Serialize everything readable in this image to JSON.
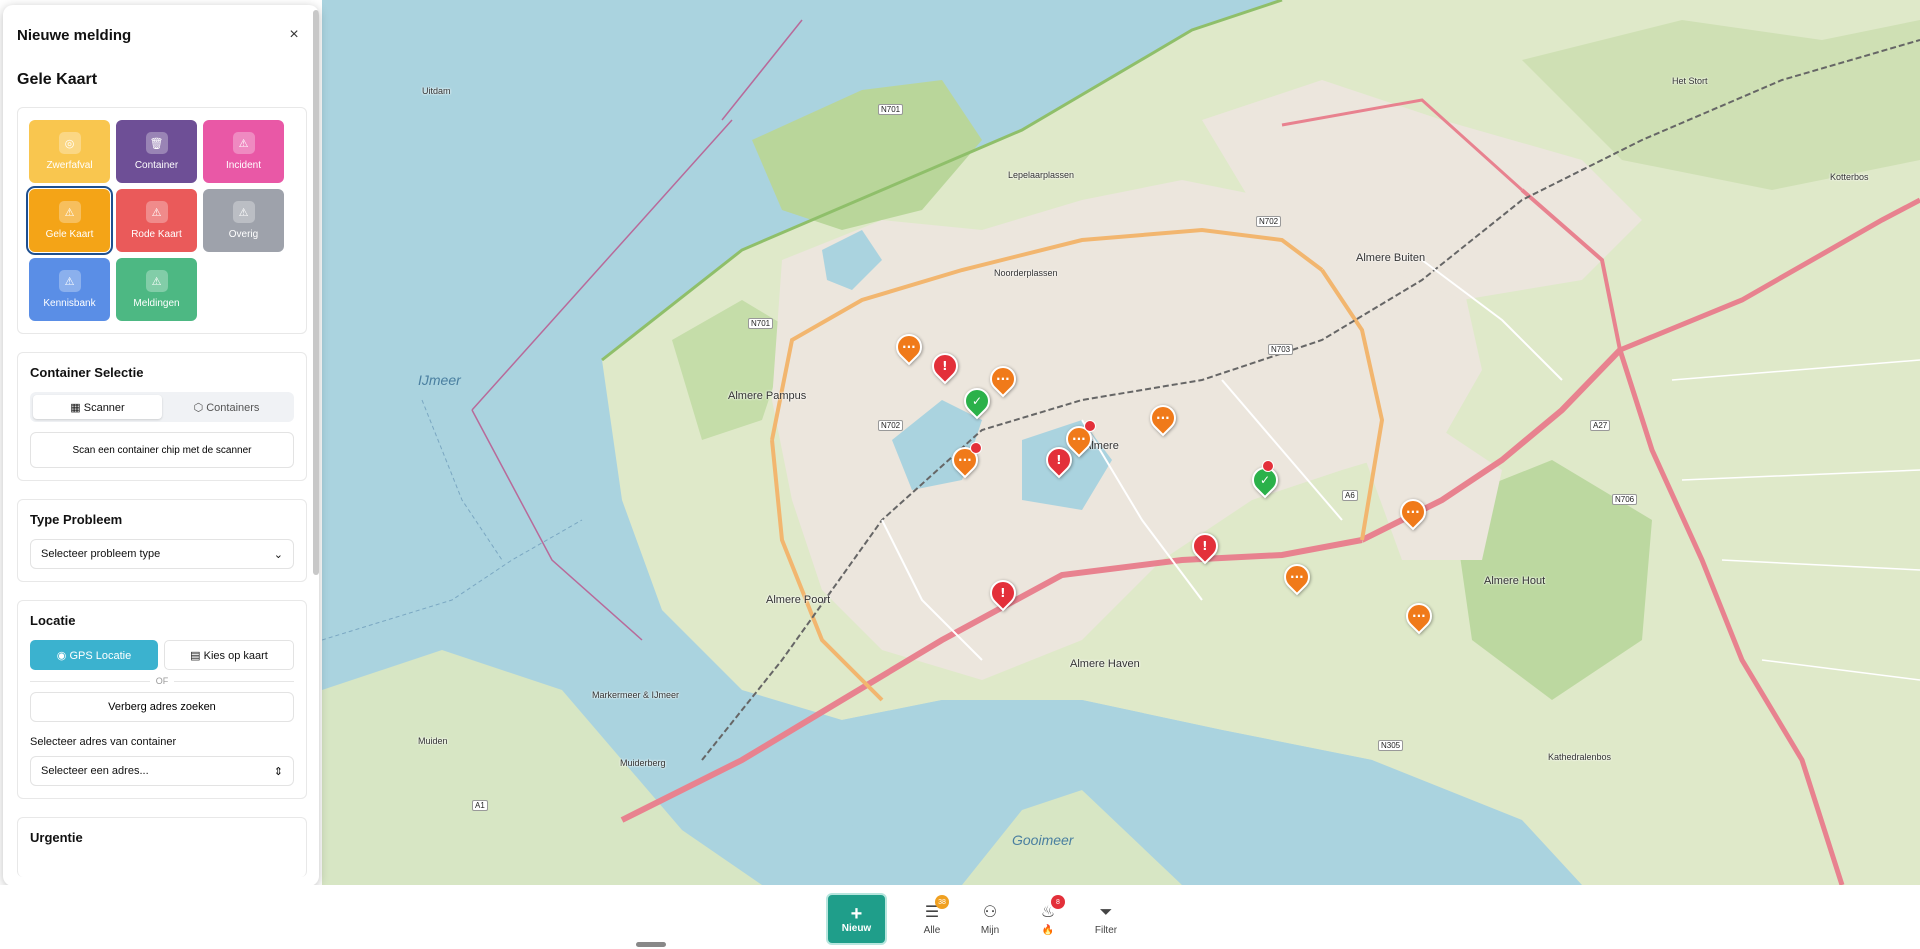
{
  "panel": {
    "title": "Nieuwe melding",
    "subtitle": "Gele Kaart",
    "close_label": "×"
  },
  "categories": [
    {
      "label": "Zwerfafval",
      "icon": "map-pin-icon",
      "color": "#f9c64f",
      "selected": false
    },
    {
      "label": "Container",
      "icon": "trash-icon",
      "color": "#6e4f96",
      "selected": false
    },
    {
      "label": "Incident",
      "icon": "warning-icon",
      "color": "#e958a6",
      "selected": false
    },
    {
      "label": "Gele Kaart",
      "icon": "warning-icon",
      "color": "#f4a417",
      "selected": true
    },
    {
      "label": "Rode Kaart",
      "icon": "warning-icon",
      "color": "#ea5a5a",
      "selected": false
    },
    {
      "label": "Overig",
      "icon": "warning-icon",
      "color": "#9ea2ab",
      "selected": false
    },
    {
      "label": "Kennisbank",
      "icon": "warning-icon",
      "color": "#5a8ee6",
      "selected": false
    },
    {
      "label": "Meldingen",
      "icon": "warning-icon",
      "color": "#4db883",
      "selected": false
    }
  ],
  "container": {
    "title": "Container Selectie",
    "tab_scanner": "Scanner",
    "tab_containers": "Containers",
    "scan_button": "Scan een container chip met de scanner"
  },
  "problem": {
    "title": "Type Probleem",
    "select_placeholder": "Selecteer probleem type"
  },
  "location": {
    "title": "Locatie",
    "gps_button": "GPS Locatie",
    "map_button": "Kies op kaart",
    "or_label": "OF",
    "hide_address_button": "Verberg adres zoeken",
    "address_label": "Selecteer adres van container",
    "address_placeholder": "Selecteer een adres..."
  },
  "urgency": {
    "title": "Urgentie"
  },
  "nav": {
    "new_label": "Nieuw",
    "all_label": "Alle",
    "all_badge": "38",
    "mine_label": "Mijn",
    "fire_label": "🔥",
    "fire_badge": "8",
    "filter_label": "Filter"
  },
  "map": {
    "labels": {
      "ijmeer": "IJmeer",
      "gooimeer": "Gooimeer",
      "almere_pampus": "Almere Pampus",
      "almere_poort": "Almere Poort",
      "almere_haven": "Almere Haven",
      "almere_buiten": "Almere Buiten",
      "almere_hout": "Almere Hout",
      "almere": "Almere",
      "muiden": "Muiden",
      "muiderberg": "Muiderberg",
      "uitdam": "Uitdam",
      "lepelaarplassen": "Lepelaarplassen",
      "noorderplassen": "Noorderplassen",
      "het_stort": "Het Stort",
      "kathedralenbos": "Kathedralenbos",
      "kotterbos": "Kotterbos",
      "marker_meer": "Markermeer & IJmeer",
      "n701": "N701",
      "n702": "N702",
      "n703": "N703",
      "n305": "N305",
      "n706": "N706",
      "a6": "A6",
      "a27": "A27",
      "a1": "A1"
    }
  }
}
